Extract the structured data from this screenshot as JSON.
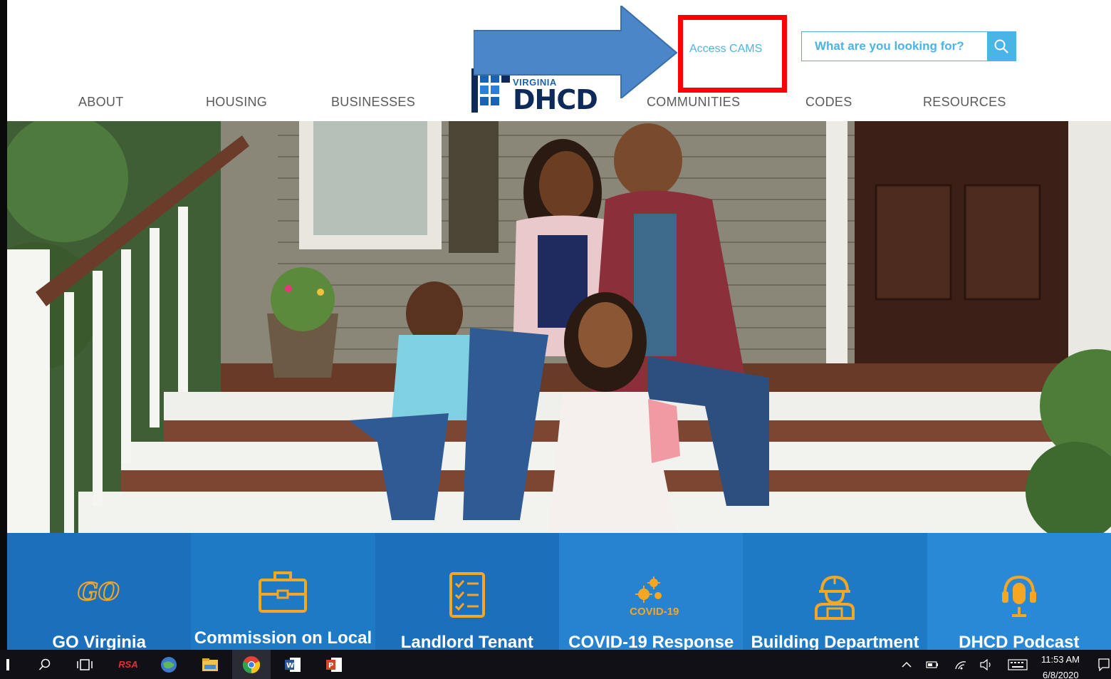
{
  "header": {
    "nav_left": [
      "ABOUT",
      "HOUSING",
      "BUSINESSES"
    ],
    "nav_right": [
      "COMMUNITIES",
      "CODES",
      "RESOURCES"
    ],
    "access_link": "Access CAMS",
    "search_placeholder": "What are you looking for?",
    "logo": {
      "line1": "VIRGINIA",
      "line2": "DHCD"
    }
  },
  "tiles": [
    {
      "label": "GO Virginia",
      "icon": "go-virginia-logo-icon",
      "color": "#1c6fbb"
    },
    {
      "label": "Commission on Local",
      "icon": "briefcase-icon",
      "color": "#1f7ac6"
    },
    {
      "label": "Landlord Tenant",
      "icon": "checklist-icon",
      "color": "#1c6fbb"
    },
    {
      "label": "COVID-19 Response",
      "icon": "covid-19-icon",
      "color": "#2783cf"
    },
    {
      "label": "Building Department",
      "icon": "worker-helmet-icon",
      "color": "#1f7ac6"
    },
    {
      "label": "DHCD Podcast",
      "icon": "microphone-headset-icon",
      "color": "#2a89d6"
    }
  ],
  "tile_icon_text": {
    "covid": "COVID-19"
  },
  "taskbar": {
    "time": "11:53 AM",
    "date": "6/8/2020",
    "apps": [
      "search-icon",
      "task-view-icon",
      "rsa-app-icon",
      "network-app-icon",
      "file-explorer-icon",
      "chrome-icon",
      "word-icon",
      "powerpoint-icon"
    ],
    "rsa_label": "RSA"
  },
  "colors": {
    "accent": "#4bb4e6",
    "tile_orange": "#f5a623",
    "annotation_red": "#ff0000",
    "annotation_arrow": "#4a86c8"
  }
}
